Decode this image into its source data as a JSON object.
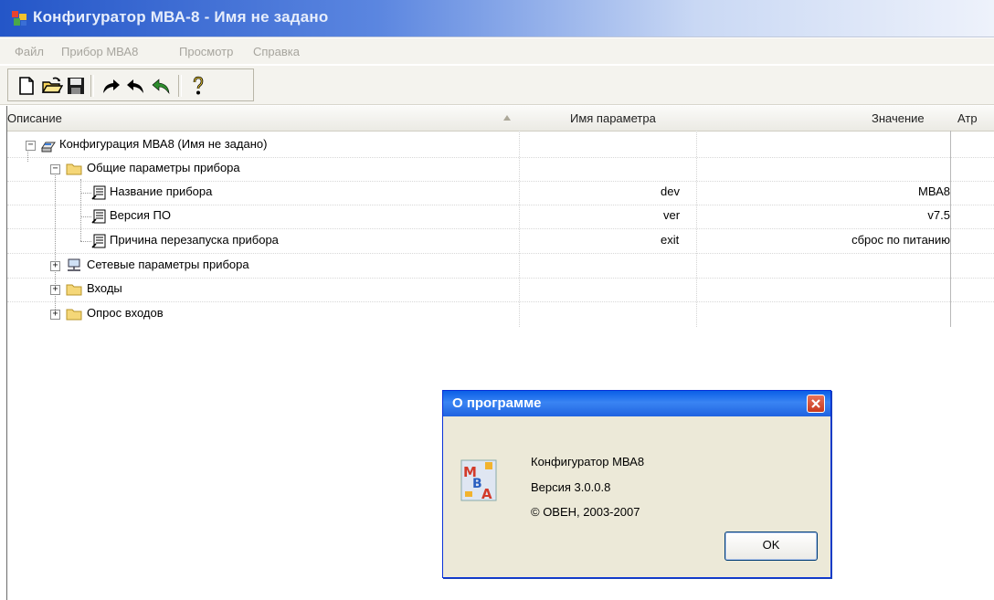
{
  "window": {
    "title": "Конфигуратор МВА-8 - Имя не задано"
  },
  "menu": [
    "Файл",
    "Прибор МВА8",
    "Просмотр",
    "Справка"
  ],
  "toolbar": [
    "new-icon",
    "open-icon",
    "save-icon",
    "redo-arrow-icon",
    "undo-arrow-icon",
    "undo-all-icon",
    "help-icon"
  ],
  "columns": {
    "description": "Описание",
    "param": "Имя параметра",
    "value": "Значение",
    "attr": "Атр"
  },
  "tree": {
    "root": "Конфигурация МВА8 (Имя не задано)",
    "group_general": "Общие параметры прибора",
    "rows": [
      {
        "label": "Название прибора",
        "param": "dev",
        "value": "МВА8"
      },
      {
        "label": "Версия ПО",
        "param": "ver",
        "value": "v7.5"
      },
      {
        "label": "Причина перезапуска прибора",
        "param": "exit",
        "value": "сброс по питанию"
      }
    ],
    "group_network": "Сетевые параметры прибора",
    "group_inputs": "Входы",
    "group_poll": "Опрос входов"
  },
  "dialog": {
    "title": "О программе",
    "line1": "Конфигуратор МВА8",
    "line2": "Версия 3.0.0.8",
    "line3": "© ОВЕН, 2003-2007",
    "ok": "OK"
  }
}
